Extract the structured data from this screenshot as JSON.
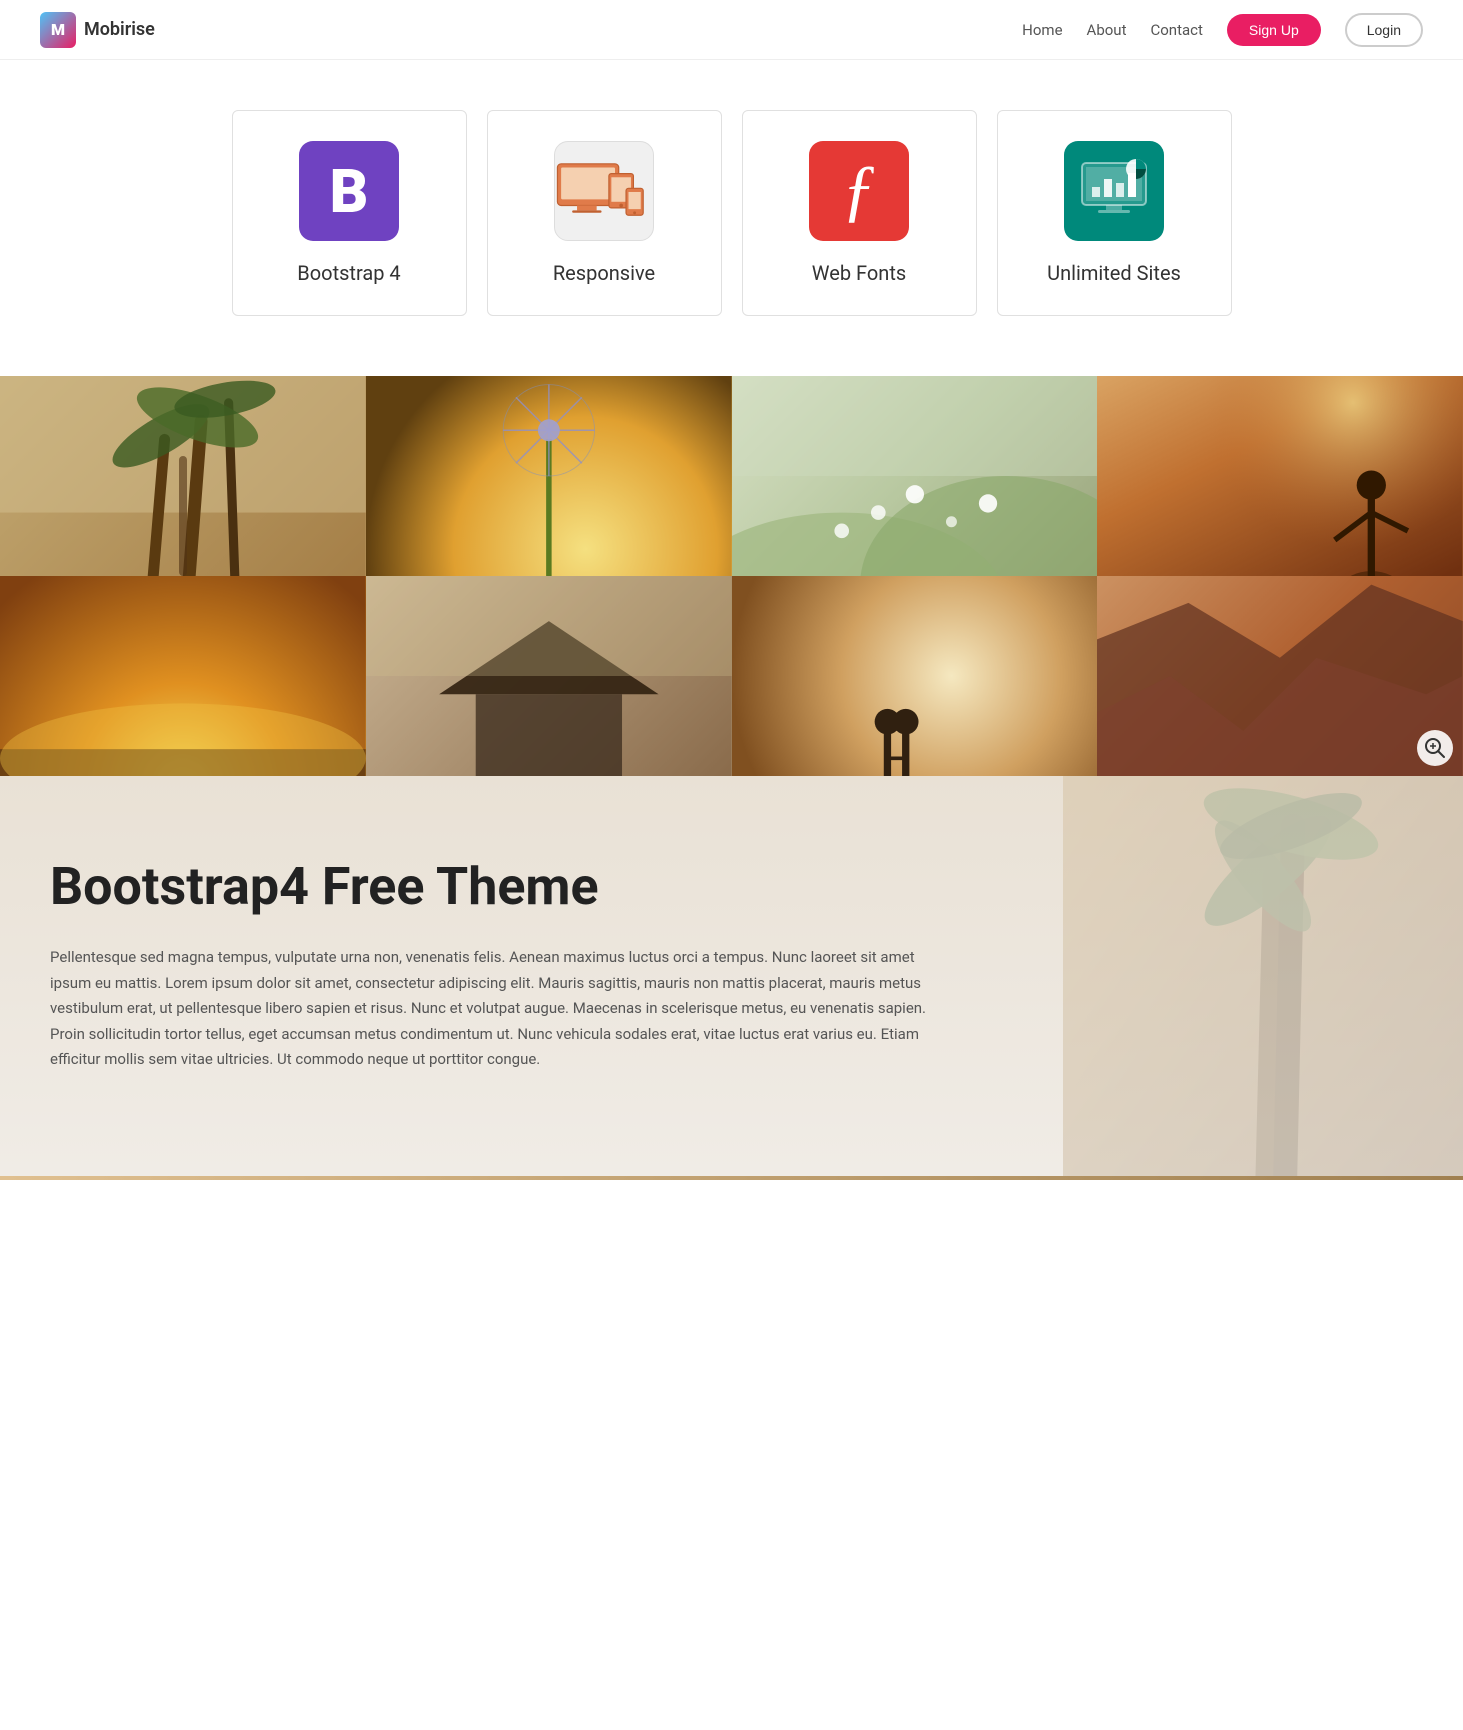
{
  "nav": {
    "brand": "Mobirise",
    "links": [
      {
        "label": "Home",
        "href": "#"
      },
      {
        "label": "About",
        "href": "#"
      },
      {
        "label": "Contact",
        "href": "#"
      }
    ],
    "signup_label": "Sign Up",
    "login_label": "Login"
  },
  "features": [
    {
      "id": "bootstrap",
      "icon_type": "bootstrap",
      "icon_text": "B",
      "title": "Bootstrap 4"
    },
    {
      "id": "responsive",
      "icon_type": "responsive",
      "icon_text": "📱",
      "title": "Responsive"
    },
    {
      "id": "webfonts",
      "icon_type": "webfonts",
      "icon_text": "ƒ",
      "title": "Web Fonts"
    },
    {
      "id": "unlimited",
      "icon_type": "unlimited",
      "icon_text": "📊",
      "title": "Unlimited Sites"
    }
  ],
  "content": {
    "heading": "Bootstrap4 Free Theme",
    "paragraph": "Pellentesque sed magna tempus, vulputate urna non, venenatis felis. Aenean maximus luctus orci a tempus. Nunc laoreet sit amet ipsum eu mattis. Lorem ipsum dolor sit amet, consectetur adipiscing elit. Mauris sagittis, mauris non mattis placerat, mauris metus vestibulum erat, ut pellentesque libero sapien et risus. Nunc et volutpat augue. Maecenas in scelerisque metus, eu venenatis sapien. Proin sollicitudin tortor tellus, eget accumsan metus condimentum ut. Nunc vehicula sodales erat, vitae luctus erat varius eu. Etiam efficitur mollis sem vitae ultricies. Ut commodo neque ut porttitor congue."
  },
  "gallery": {
    "zoom_icon": "⊕",
    "zoom_aria": "Zoom gallery"
  }
}
